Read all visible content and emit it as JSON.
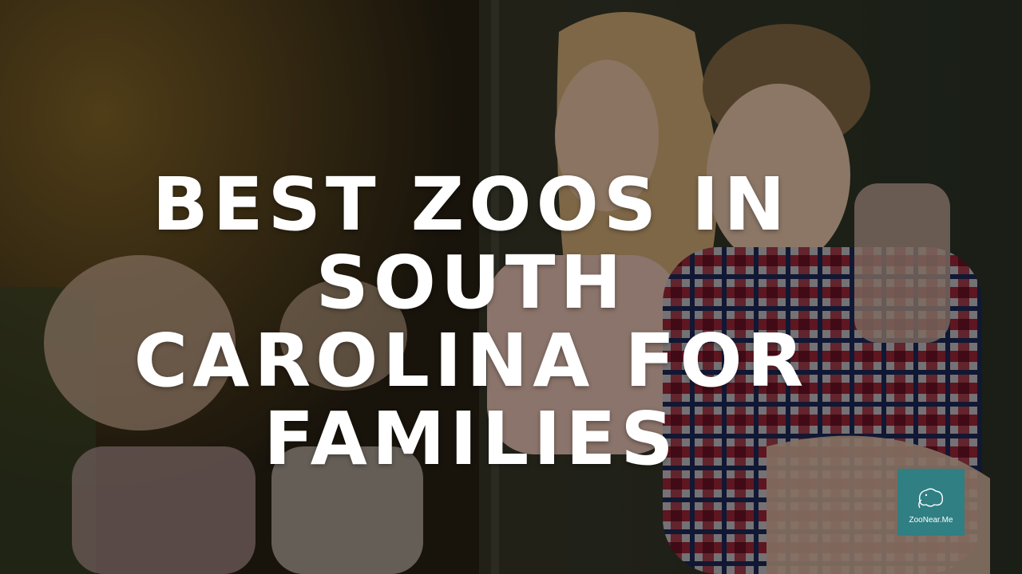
{
  "headline": {
    "lines": [
      "BEST ZOOS IN",
      "SOUTH",
      "CAROLINA FOR",
      "FAMILIES"
    ]
  },
  "logo": {
    "text": "ZooNear.Me",
    "icon": "elephant-outline-icon",
    "background": "#2f7f83"
  },
  "photo": {
    "subject": "family-at-zoo-photo"
  }
}
